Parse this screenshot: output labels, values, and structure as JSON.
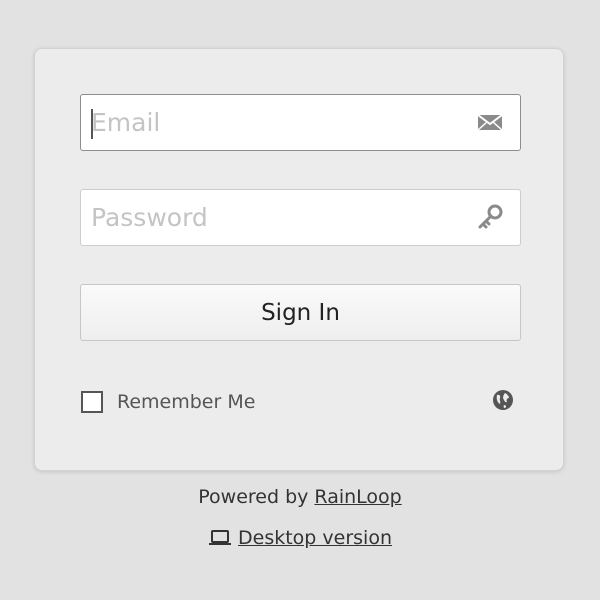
{
  "login": {
    "email_placeholder": "Email",
    "email_value": "",
    "email_icon": "envelope-icon",
    "password_placeholder": "Password",
    "password_value": "",
    "password_icon": "key-icon",
    "signin_label": "Sign In",
    "remember_label": "Remember Me",
    "remember_checked": false,
    "language_icon": "globe-icon"
  },
  "footer": {
    "powered_prefix": "Powered by",
    "powered_link": "RainLoop",
    "desktop_icon": "laptop-icon",
    "desktop_link": "Desktop version"
  },
  "colors": {
    "background": "#e2e2e2",
    "card": "#ececec",
    "text": "#333333",
    "placeholder": "#c4c4c4"
  }
}
